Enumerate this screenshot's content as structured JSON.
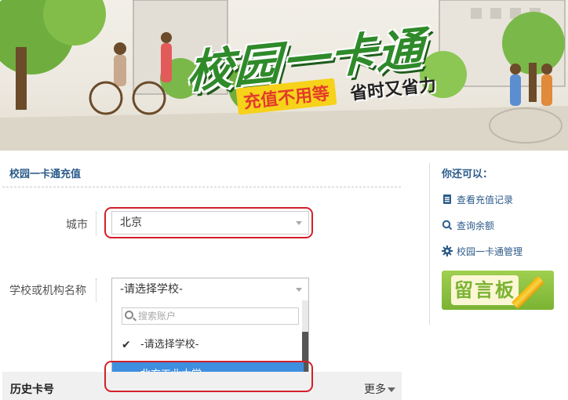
{
  "banner": {
    "title": "校园一卡通",
    "slogan_left": "充值不用等",
    "slogan_right": "省时又省力"
  },
  "main": {
    "section_title": "校园一卡通充值",
    "city_label": "城市",
    "city_value": "北京",
    "school_label": "学校或机构名称",
    "school_value": "-请选择学校-",
    "dropdown": {
      "search_placeholder": "搜索账户",
      "options": [
        {
          "label": "-请选择学校-",
          "checked": true
        },
        {
          "label": "北方工业大学",
          "highlighted": true
        }
      ]
    },
    "history": {
      "title": "历史卡号",
      "more": "更多"
    }
  },
  "side": {
    "title": "你还可以：",
    "links": [
      {
        "label": "查看充值记录",
        "icon": "document-icon"
      },
      {
        "label": "查询余额",
        "icon": "search-icon"
      },
      {
        "label": "校园一卡通管理",
        "icon": "gear-icon"
      }
    ],
    "board_label": "留言板"
  },
  "colors": {
    "link_blue": "#2c5b8a",
    "highlight_blue": "#3e8fe0",
    "annotation_red": "#d3202a",
    "banner_green": "#2f8a2a"
  }
}
